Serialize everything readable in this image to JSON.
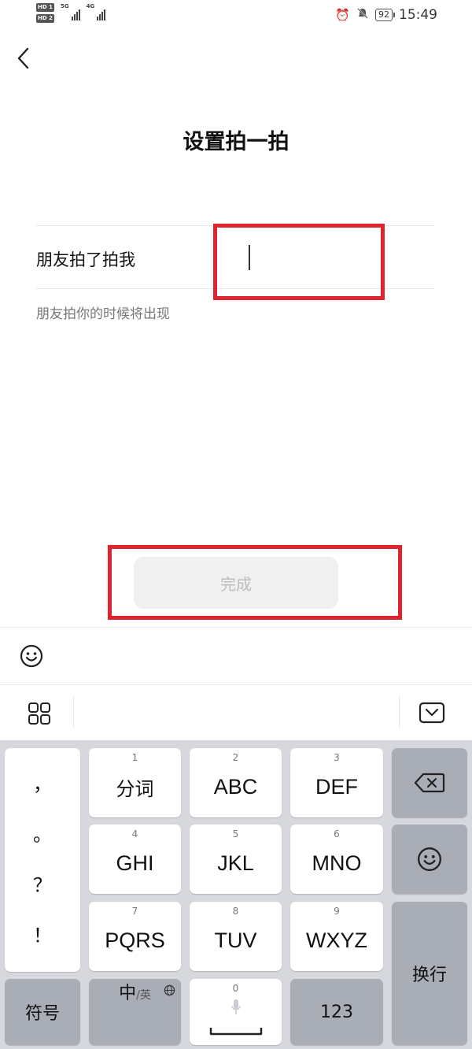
{
  "status_bar": {
    "hd1": "HD 1",
    "hd2": "HD 2",
    "net1": "5G",
    "net2": "4G",
    "battery": "92",
    "time": "15:49"
  },
  "header": {
    "title": "设置拍一拍"
  },
  "form": {
    "field_label": "朋友拍了拍我",
    "field_value": "",
    "hint": "朋友拍你的时候将出现"
  },
  "actions": {
    "done_label": "完成"
  },
  "keyboard": {
    "punctuation": [
      "，",
      "。",
      "？",
      "！"
    ],
    "keys": [
      {
        "num": "1",
        "label": "分词"
      },
      {
        "num": "2",
        "label": "ABC"
      },
      {
        "num": "3",
        "label": "DEF"
      },
      {
        "num": "4",
        "label": "GHI"
      },
      {
        "num": "5",
        "label": "JKL"
      },
      {
        "num": "6",
        "label": "MNO"
      },
      {
        "num": "7",
        "label": "PQRS"
      },
      {
        "num": "8",
        "label": "TUV"
      },
      {
        "num": "9",
        "label": "WXYZ"
      }
    ],
    "symbols_label": "符号",
    "lang_main": "中",
    "lang_sub": "/英",
    "space_num": "0",
    "numeric_label": "123",
    "enter_label": "换行"
  },
  "colors": {
    "highlight": "#e0242e",
    "keyboard_bg": "#d6d8de",
    "dark_key": "#a9adb6",
    "disabled_button": "#f0f0f0"
  }
}
